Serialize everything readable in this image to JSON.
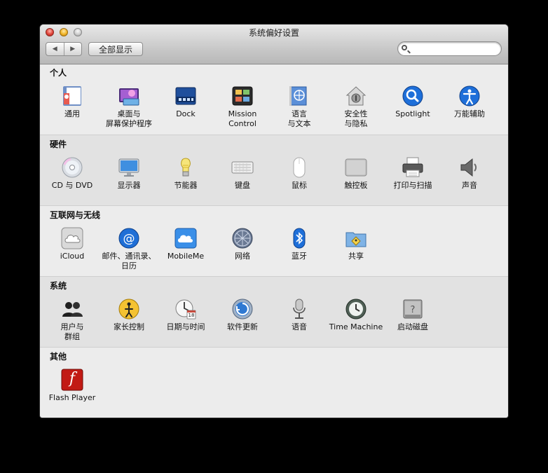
{
  "window": {
    "title": "系统偏好设置"
  },
  "toolbar": {
    "back": "◀",
    "forward": "▶",
    "show_all": "全部显示",
    "search_value": ""
  },
  "sections": [
    {
      "title": "个人",
      "items": [
        {
          "label": "通用",
          "icon": "general-icon"
        },
        {
          "label": "桌面与\n屏幕保护程序",
          "icon": "desktop-icon"
        },
        {
          "label": "Dock",
          "icon": "dock-icon"
        },
        {
          "label": "Mission\nControl",
          "icon": "mission-control-icon"
        },
        {
          "label": "语言\n与文本",
          "icon": "language-icon"
        },
        {
          "label": "安全性\n与隐私",
          "icon": "security-icon"
        },
        {
          "label": "Spotlight",
          "icon": "spotlight-icon"
        },
        {
          "label": "万能辅助",
          "icon": "accessibility-icon"
        }
      ]
    },
    {
      "title": "硬件",
      "items": [
        {
          "label": "CD 与 DVD",
          "icon": "cd-icon"
        },
        {
          "label": "显示器",
          "icon": "display-icon"
        },
        {
          "label": "节能器",
          "icon": "energy-saver-icon"
        },
        {
          "label": "键盘",
          "icon": "keyboard-icon"
        },
        {
          "label": "鼠标",
          "icon": "mouse-icon"
        },
        {
          "label": "触控板",
          "icon": "trackpad-icon"
        },
        {
          "label": "打印与扫描",
          "icon": "printer-icon"
        },
        {
          "label": "声音",
          "icon": "speaker-icon"
        }
      ]
    },
    {
      "title": "互联网与无线",
      "items": [
        {
          "label": "iCloud",
          "icon": "icloud-icon"
        },
        {
          "label": "邮件、通讯录、\n日历",
          "icon": "mail-icon"
        },
        {
          "label": "MobileMe",
          "icon": "mobileme-icon"
        },
        {
          "label": "网络",
          "icon": "network-icon"
        },
        {
          "label": "蓝牙",
          "icon": "bluetooth-icon"
        },
        {
          "label": "共享",
          "icon": "sharing-icon"
        }
      ]
    },
    {
      "title": "系统",
      "items": [
        {
          "label": "用户与\n群组",
          "icon": "users-icon"
        },
        {
          "label": "家长控制",
          "icon": "parental-controls-icon"
        },
        {
          "label": "日期与时间",
          "icon": "date-time-icon",
          "badge": "18"
        },
        {
          "label": "软件更新",
          "icon": "software-update-icon"
        },
        {
          "label": "语音",
          "icon": "microphone-icon"
        },
        {
          "label": "Time Machine",
          "icon": "time-machine-icon"
        },
        {
          "label": "启动磁盘",
          "icon": "startup-disk-icon"
        }
      ]
    },
    {
      "title": "其他",
      "items": [
        {
          "label": "Flash Player",
          "icon": "flash-icon",
          "glyph": "f"
        }
      ]
    }
  ]
}
